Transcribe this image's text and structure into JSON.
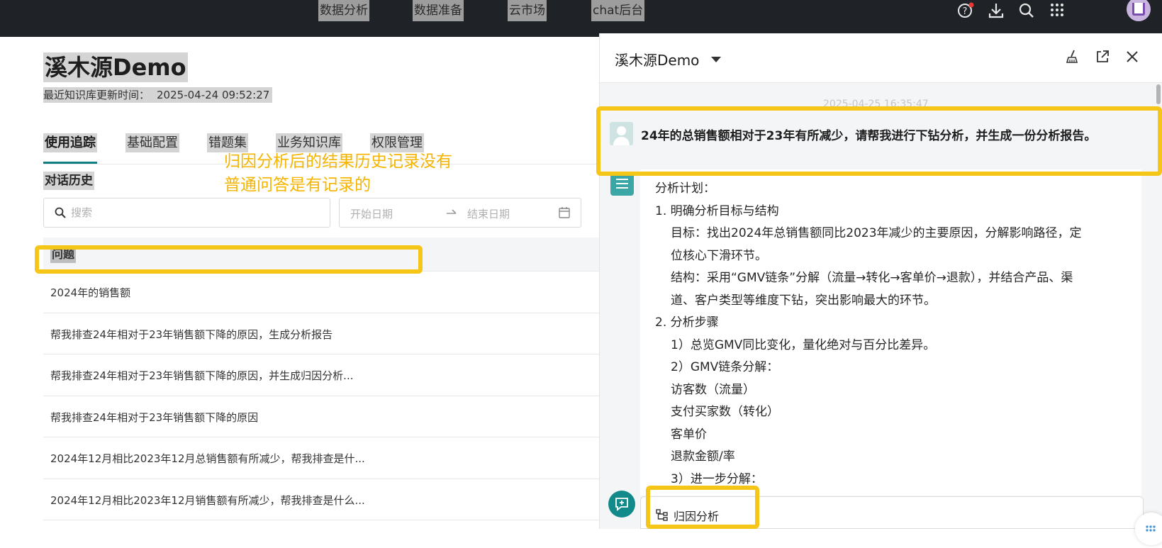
{
  "top_nav": {
    "items": [
      "数据分析",
      "数据准备",
      "云市场",
      "chat后台"
    ]
  },
  "left": {
    "app_title": "溪木源Demo",
    "update_label": "最近知识库更新时间：",
    "update_value": "2025-04-24 09:52:27",
    "tabs": [
      "使用追踪",
      "基础配置",
      "错题集",
      "业务知识库",
      "权限管理"
    ],
    "active_tab": "使用追踪",
    "section_title": "对话历史",
    "search_placeholder": "搜索",
    "date_start_placeholder": "开始日期",
    "date_end_placeholder": "结束日期",
    "table_header": "问题",
    "rows": [
      "2024年的销售额",
      "帮我排查24年相对于23年销售额下降的原因，生成分析报告",
      "帮我排查24年相对于23年销售额下降的原因，并生成归因分析...",
      "帮我排查24年相对于23年销售额下降的原因",
      "2024年12月相比2023年12月总销售额有所减少，帮我排查是什...",
      "2024年12月相比2023年12月销售额有所减少，帮我排查是什么..."
    ],
    "annotation_line1": "归因分析后的结果历史记录没有",
    "annotation_line2": "普通问答是有记录的"
  },
  "right": {
    "title": "溪木源Demo",
    "timestamp": "2025-04-25 16:35:47",
    "user_message": "24年的总销售额相对于23年有所减少，请帮我进行下钻分析，并生成一份分析报告。",
    "bot_lines": [
      {
        "text": "分析计划：",
        "indent": 0
      },
      {
        "text": "1. 明确分析目标与结构",
        "indent": 0
      },
      {
        "text": "目标：找出2024年总销售额同比2023年减少的主要原因，分解影响路径，定",
        "indent": 1
      },
      {
        "text": "位核心下滑环节。",
        "indent": 1
      },
      {
        "text": "结构：采用“GMV链条”分解（流量→转化→客单价→退款），并结合产品、渠",
        "indent": 1
      },
      {
        "text": "道、客户类型等维度下钻，突出影响最大的环节。",
        "indent": 1
      },
      {
        "text": "2. 分析步骤",
        "indent": 0
      },
      {
        "text": "1）总览GMV同比变化，量化绝对与百分比差异。",
        "indent": 1
      },
      {
        "text": "2）GMV链条分解：",
        "indent": 1
      },
      {
        "text": "访客数（流量）",
        "indent": 1
      },
      {
        "text": "支付买家数（转化）",
        "indent": 1
      },
      {
        "text": "客单价",
        "indent": 1
      },
      {
        "text": "退款金额/率",
        "indent": 1
      },
      {
        "text": "3）进一步分解：",
        "indent": 1
      }
    ],
    "attribution_button": "归因分析"
  },
  "colors": {
    "topbar": "#1f2328",
    "accent_teal": "#0f7f86",
    "annotation_yellow": "#f5c518",
    "annotation_text": "#f5b400"
  }
}
